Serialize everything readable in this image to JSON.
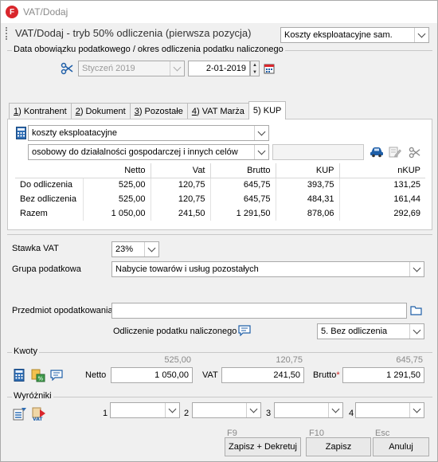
{
  "window": {
    "title": "VAT/Dodaj",
    "app_icon": "F"
  },
  "header": {
    "heading": "VAT/Dodaj - tryb 50% odliczenia (pierwsza pozycja)",
    "category_select": "Koszty eksploatacyjne sam."
  },
  "period": {
    "group_label": "Data obowiązku podatkowego / okres odliczenia podatku naliczonego",
    "month_select": "Styczeń 2019",
    "date_value": "2-01-2019"
  },
  "tabs": [
    {
      "key": "1",
      "label": "Kontrahent"
    },
    {
      "key": "2",
      "label": "Dokument"
    },
    {
      "key": "3",
      "label": "Pozostałe"
    },
    {
      "key": "4",
      "label": "VAT Marża"
    },
    {
      "key": "5",
      "label": "KUP"
    }
  ],
  "kup": {
    "type_select": "koszty eksploatacyjne",
    "vehicle_select": "osobowy do działalności gospodarczej i innych celów",
    "vehicle_field": "",
    "table": {
      "headers": [
        "",
        "Netto",
        "Vat",
        "Brutto",
        "KUP",
        "nKUP"
      ],
      "rows": [
        {
          "label": "Do odliczenia",
          "values": [
            "525,00",
            "120,75",
            "645,75",
            "393,75",
            "131,25"
          ]
        },
        {
          "label": "Bez odliczenia",
          "values": [
            "525,00",
            "120,75",
            "645,75",
            "484,31",
            "161,44"
          ]
        },
        {
          "label": "Razem",
          "values": [
            "1 050,00",
            "241,50",
            "1 291,50",
            "878,06",
            "292,69"
          ]
        }
      ]
    }
  },
  "form": {
    "stawka_label": "Stawka VAT",
    "stawka_value": "23%",
    "grupa_label": "Grupa podatkowa",
    "grupa_value": "Nabycie towarów i usług pozostałych",
    "przedmiot_label": "Przedmiot opodatkowania",
    "przedmiot_value": "",
    "odliczenie_label": "Odliczenie podatku naliczonego",
    "odliczenie_value": "5. Bez odliczenia"
  },
  "kwoty": {
    "group_label": "Kwoty",
    "hint_netto": "525,00",
    "hint_vat": "120,75",
    "hint_brutto": "645,75",
    "netto_label": "Netto",
    "netto_value": "1 050,00",
    "vat_label": "VAT",
    "vat_value": "241,50",
    "brutto_label": "Brutto",
    "brutto_required": "*",
    "brutto_value": "1 291,50"
  },
  "wyrozniki": {
    "group_label": "Wyróżniki",
    "labels": [
      "1",
      "2",
      "3",
      "4"
    ]
  },
  "buttons": {
    "save_post_key": "F9",
    "save_post_label": "Zapisz + Dekretuj",
    "save_key": "F10",
    "save_label": "Zapisz",
    "cancel_key": "Esc",
    "cancel_label": "Anuluj"
  },
  "colors": {
    "app_icon": "#d9262c",
    "car_icon": "#1f5fa8",
    "calculator_icon": "#2e6db4",
    "required_marker": "#d32020"
  }
}
